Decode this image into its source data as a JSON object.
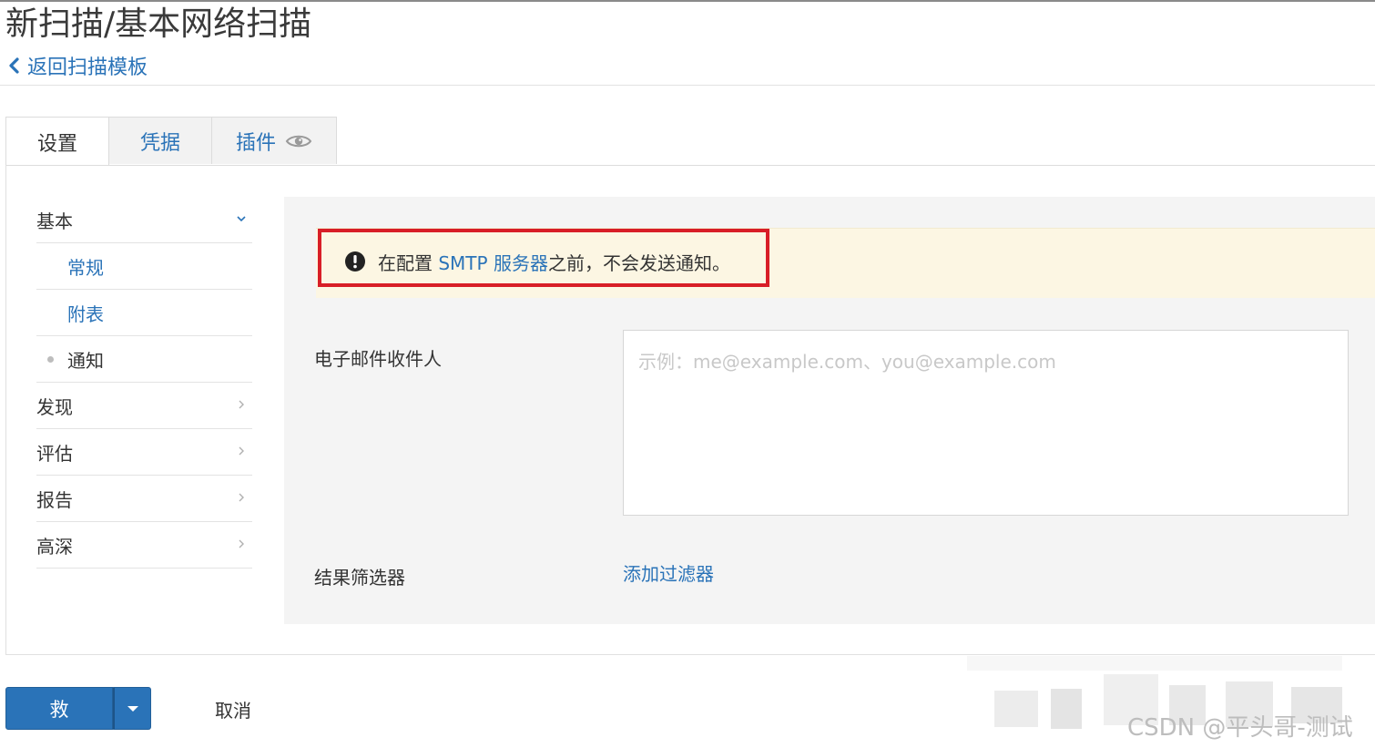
{
  "header": {
    "title": "新扫描/基本网络扫描",
    "back_label": "返回扫描模板"
  },
  "tabs": [
    {
      "label": "设置",
      "active": true
    },
    {
      "label": "凭据",
      "active": false
    },
    {
      "label": "插件",
      "active": false,
      "icon": "eye-icon"
    }
  ],
  "sidebar": {
    "items": [
      {
        "label": "基本",
        "expanded": true,
        "icon": "chevron-down-icon"
      },
      {
        "label": "常规"
      },
      {
        "label": "附表"
      },
      {
        "label": "通知",
        "current": true
      },
      {
        "label": "发现",
        "icon": "chevron-right-icon"
      },
      {
        "label": "评估",
        "icon": "chevron-right-icon"
      },
      {
        "label": "报告",
        "icon": "chevron-right-icon"
      },
      {
        "label": "高深",
        "icon": "chevron-right-icon"
      }
    ]
  },
  "alert": {
    "icon": "exclamation-circle-icon",
    "text_before": "在配置 ",
    "link_text": "SMTP 服务器",
    "text_after": "之前，不会发送通知。"
  },
  "form": {
    "email_label": "电子邮件收件人",
    "email_placeholder": "示例：me@example.com、you@example.com",
    "email_value": "",
    "filter_label": "结果筛选器",
    "add_filter_label": "添加过滤器"
  },
  "actions": {
    "save_label": "救",
    "cancel_label": "取消"
  },
  "watermark": "CSDN @平头哥-测试",
  "colors": {
    "link": "#2a73b8",
    "alert_bg": "#fcf6e3",
    "alert_highlight": "#d81e27",
    "primary_button": "#2a73b8"
  }
}
